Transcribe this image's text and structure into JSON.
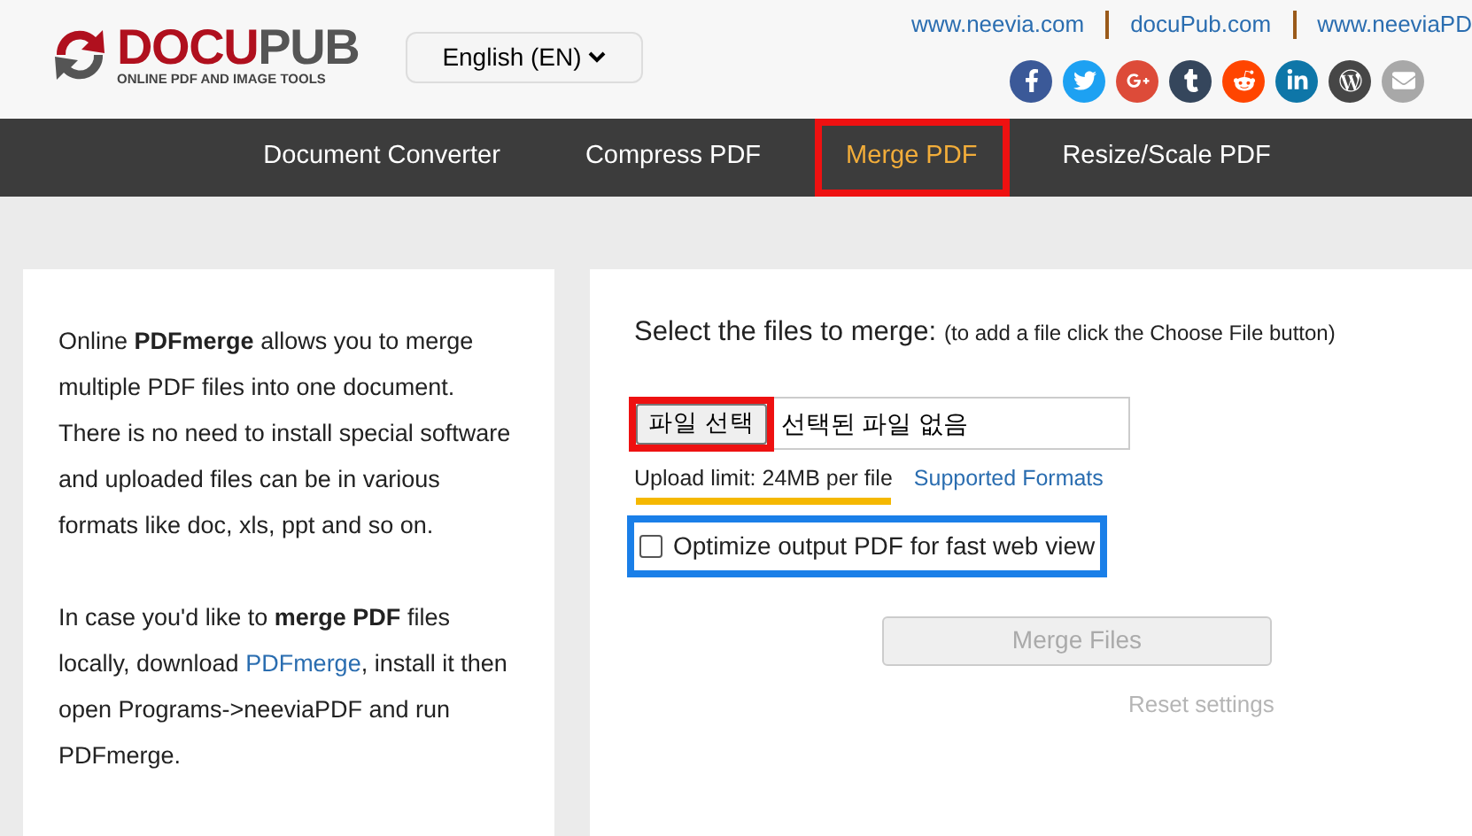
{
  "header": {
    "logo": {
      "word_parts": [
        "DOCU",
        "PUB"
      ],
      "tagline": "ONLINE PDF AND IMAGE TOOLS"
    },
    "language_select": {
      "value": "English (EN)"
    },
    "site_links": [
      "www.neevia.com",
      "docuPub.com",
      "www.neeviaPD"
    ],
    "social": [
      {
        "kind": "facebook",
        "color": "#3b5998"
      },
      {
        "kind": "twitter",
        "color": "#1da1f2"
      },
      {
        "kind": "google",
        "color": "#dd4b39"
      },
      {
        "kind": "tumblr",
        "color": "#35465c"
      },
      {
        "kind": "reddit",
        "color": "#ff4500"
      },
      {
        "kind": "linkedin",
        "color": "#0e76a8"
      },
      {
        "kind": "wordpress",
        "color": "#464646"
      },
      {
        "kind": "email",
        "color": "#a8a8a8"
      }
    ]
  },
  "nav": [
    {
      "label": "Document Converter",
      "selected": false
    },
    {
      "label": "Compress PDF",
      "selected": false
    },
    {
      "label": "Merge PDF",
      "selected": true,
      "highlight": {
        "kind": "box",
        "color": "#ee1111"
      }
    },
    {
      "label": "Resize/Scale PDF",
      "selected": false
    }
  ],
  "intro": {
    "paragraphs": [
      {
        "text": "Online **PDFmerge** allows you to merge multiple PDF files into one document. There is no need to install special software and uploaded files can be in various formats like doc, xls, ppt and so on."
      },
      {
        "text": "In case you'd like to **merge PDF** files locally, download ",
        "link": "PDFmerge",
        "after": ", install it then open Programs->neeviaPDF and run PDFmerge."
      }
    ]
  },
  "form": {
    "heading": "Select the files to merge:",
    "hint": "(to add a file click the Choose File button)",
    "file_input": {
      "button": "파일 선택",
      "status": "선택된 파일 없음",
      "highlight": {
        "kind": "box",
        "color": "#ee1111"
      }
    },
    "upload_limit": {
      "text": "Upload limit: 24MB per file",
      "highlight": {
        "kind": "underline",
        "color": "#f5b800"
      }
    },
    "formats_link": "Supported Formats",
    "optimize": {
      "label": "Optimize output PDF for fast web view",
      "checked": false,
      "highlight": {
        "kind": "box",
        "color": "#1a7fe8"
      }
    },
    "merge_button": {
      "label": "Merge Files",
      "disabled": true
    },
    "reset_link": {
      "label": "Reset settings",
      "disabled": true
    }
  }
}
